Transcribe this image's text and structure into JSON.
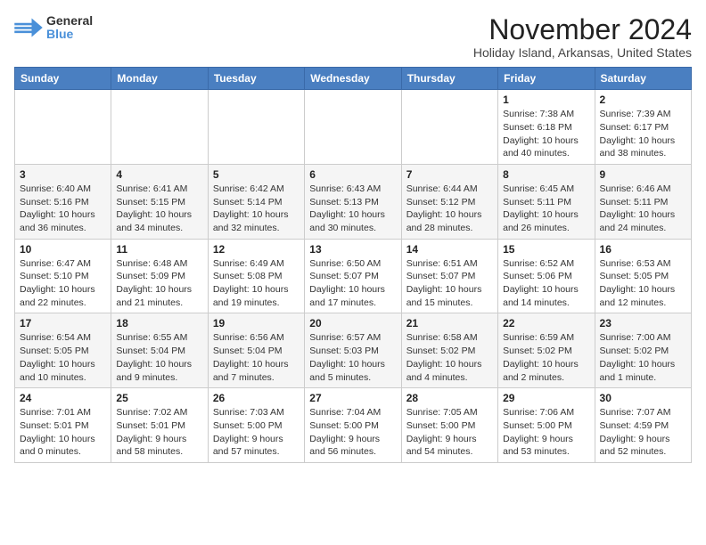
{
  "logo": {
    "general": "General",
    "blue": "Blue"
  },
  "title": "November 2024",
  "subtitle": "Holiday Island, Arkansas, United States",
  "weekdays": [
    "Sunday",
    "Monday",
    "Tuesday",
    "Wednesday",
    "Thursday",
    "Friday",
    "Saturday"
  ],
  "weeks": [
    [
      {
        "day": "",
        "info": ""
      },
      {
        "day": "",
        "info": ""
      },
      {
        "day": "",
        "info": ""
      },
      {
        "day": "",
        "info": ""
      },
      {
        "day": "",
        "info": ""
      },
      {
        "day": "1",
        "info": "Sunrise: 7:38 AM\nSunset: 6:18 PM\nDaylight: 10 hours and 40 minutes."
      },
      {
        "day": "2",
        "info": "Sunrise: 7:39 AM\nSunset: 6:17 PM\nDaylight: 10 hours and 38 minutes."
      }
    ],
    [
      {
        "day": "3",
        "info": "Sunrise: 6:40 AM\nSunset: 5:16 PM\nDaylight: 10 hours and 36 minutes."
      },
      {
        "day": "4",
        "info": "Sunrise: 6:41 AM\nSunset: 5:15 PM\nDaylight: 10 hours and 34 minutes."
      },
      {
        "day": "5",
        "info": "Sunrise: 6:42 AM\nSunset: 5:14 PM\nDaylight: 10 hours and 32 minutes."
      },
      {
        "day": "6",
        "info": "Sunrise: 6:43 AM\nSunset: 5:13 PM\nDaylight: 10 hours and 30 minutes."
      },
      {
        "day": "7",
        "info": "Sunrise: 6:44 AM\nSunset: 5:12 PM\nDaylight: 10 hours and 28 minutes."
      },
      {
        "day": "8",
        "info": "Sunrise: 6:45 AM\nSunset: 5:11 PM\nDaylight: 10 hours and 26 minutes."
      },
      {
        "day": "9",
        "info": "Sunrise: 6:46 AM\nSunset: 5:11 PM\nDaylight: 10 hours and 24 minutes."
      }
    ],
    [
      {
        "day": "10",
        "info": "Sunrise: 6:47 AM\nSunset: 5:10 PM\nDaylight: 10 hours and 22 minutes."
      },
      {
        "day": "11",
        "info": "Sunrise: 6:48 AM\nSunset: 5:09 PM\nDaylight: 10 hours and 21 minutes."
      },
      {
        "day": "12",
        "info": "Sunrise: 6:49 AM\nSunset: 5:08 PM\nDaylight: 10 hours and 19 minutes."
      },
      {
        "day": "13",
        "info": "Sunrise: 6:50 AM\nSunset: 5:07 PM\nDaylight: 10 hours and 17 minutes."
      },
      {
        "day": "14",
        "info": "Sunrise: 6:51 AM\nSunset: 5:07 PM\nDaylight: 10 hours and 15 minutes."
      },
      {
        "day": "15",
        "info": "Sunrise: 6:52 AM\nSunset: 5:06 PM\nDaylight: 10 hours and 14 minutes."
      },
      {
        "day": "16",
        "info": "Sunrise: 6:53 AM\nSunset: 5:05 PM\nDaylight: 10 hours and 12 minutes."
      }
    ],
    [
      {
        "day": "17",
        "info": "Sunrise: 6:54 AM\nSunset: 5:05 PM\nDaylight: 10 hours and 10 minutes."
      },
      {
        "day": "18",
        "info": "Sunrise: 6:55 AM\nSunset: 5:04 PM\nDaylight: 10 hours and 9 minutes."
      },
      {
        "day": "19",
        "info": "Sunrise: 6:56 AM\nSunset: 5:04 PM\nDaylight: 10 hours and 7 minutes."
      },
      {
        "day": "20",
        "info": "Sunrise: 6:57 AM\nSunset: 5:03 PM\nDaylight: 10 hours and 5 minutes."
      },
      {
        "day": "21",
        "info": "Sunrise: 6:58 AM\nSunset: 5:02 PM\nDaylight: 10 hours and 4 minutes."
      },
      {
        "day": "22",
        "info": "Sunrise: 6:59 AM\nSunset: 5:02 PM\nDaylight: 10 hours and 2 minutes."
      },
      {
        "day": "23",
        "info": "Sunrise: 7:00 AM\nSunset: 5:02 PM\nDaylight: 10 hours and 1 minute."
      }
    ],
    [
      {
        "day": "24",
        "info": "Sunrise: 7:01 AM\nSunset: 5:01 PM\nDaylight: 10 hours and 0 minutes."
      },
      {
        "day": "25",
        "info": "Sunrise: 7:02 AM\nSunset: 5:01 PM\nDaylight: 9 hours and 58 minutes."
      },
      {
        "day": "26",
        "info": "Sunrise: 7:03 AM\nSunset: 5:00 PM\nDaylight: 9 hours and 57 minutes."
      },
      {
        "day": "27",
        "info": "Sunrise: 7:04 AM\nSunset: 5:00 PM\nDaylight: 9 hours and 56 minutes."
      },
      {
        "day": "28",
        "info": "Sunrise: 7:05 AM\nSunset: 5:00 PM\nDaylight: 9 hours and 54 minutes."
      },
      {
        "day": "29",
        "info": "Sunrise: 7:06 AM\nSunset: 5:00 PM\nDaylight: 9 hours and 53 minutes."
      },
      {
        "day": "30",
        "info": "Sunrise: 7:07 AM\nSunset: 4:59 PM\nDaylight: 9 hours and 52 minutes."
      }
    ]
  ]
}
